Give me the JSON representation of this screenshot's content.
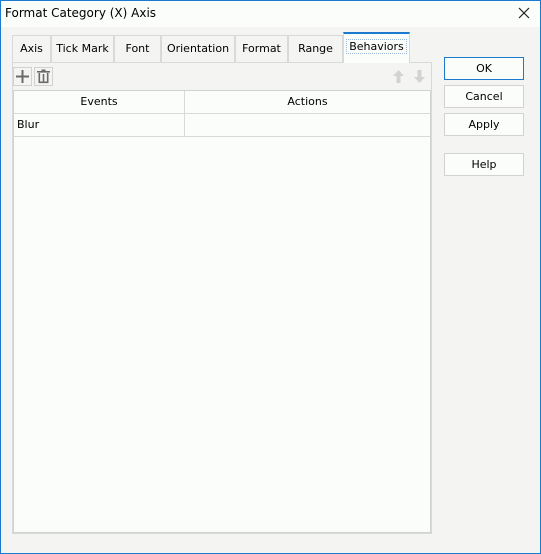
{
  "window": {
    "title": "Format Category (X) Axis",
    "close_icon": "close-x-icon"
  },
  "tabs": [
    {
      "label": "Axis",
      "active": false
    },
    {
      "label": "Tick Mark",
      "active": false
    },
    {
      "label": "Font",
      "active": false
    },
    {
      "label": "Orientation",
      "active": false
    },
    {
      "label": "Format",
      "active": false
    },
    {
      "label": "Range",
      "active": false
    },
    {
      "label": "Behaviors",
      "active": true
    }
  ],
  "toolbar": {
    "add_icon": "plus-icon",
    "delete_icon": "trash-icon",
    "move_up_icon": "arrow-up-icon",
    "move_down_icon": "arrow-down-icon"
  },
  "table": {
    "columns": [
      "Events",
      "Actions"
    ],
    "rows": [
      [
        "Blur",
        ""
      ]
    ]
  },
  "buttons": {
    "ok": "OK",
    "cancel": "Cancel",
    "apply": "Apply",
    "help": "Help"
  },
  "colors": {
    "accent": "#1a7ad0",
    "background": "#f4f5f3",
    "content": "#fbfdfb",
    "border": "#d9d9d9"
  }
}
